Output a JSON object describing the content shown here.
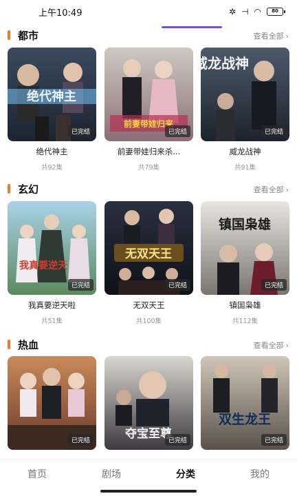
{
  "status_bar": {
    "time": "上午10:49",
    "battery": "80"
  },
  "sections": [
    {
      "title": "都市",
      "more": "查看全部",
      "items": [
        {
          "title": "绝代神主",
          "episodes": "共92集",
          "badge": "已完结",
          "poster_text": "绝代神主"
        },
        {
          "title": "前妻带娃归来杀...",
          "episodes": "共79集",
          "badge": "已完结",
          "poster_text": "前妻带娃归来"
        },
        {
          "title": "威龙战神",
          "episodes": "共91集",
          "badge": "已完结",
          "poster_text": "威龙战神"
        }
      ]
    },
    {
      "title": "玄幻",
      "more": "查看全部",
      "items": [
        {
          "title": "我真要逆天啦",
          "episodes": "共51集",
          "badge": "已完结",
          "poster_text": "我真要逆天"
        },
        {
          "title": "无双天王",
          "episodes": "共100集",
          "badge": "已完结",
          "poster_text": "无双天王"
        },
        {
          "title": "镇国枭雄",
          "episodes": "共112集",
          "badge": "已完结",
          "poster_text": "镇国枭雄"
        }
      ]
    },
    {
      "title": "热血",
      "more": "查看全部",
      "items": [
        {
          "title": "",
          "episodes": "",
          "badge": "已完结",
          "poster_text": ""
        },
        {
          "title": "",
          "episodes": "",
          "badge": "已完结",
          "poster_text": "夺宝至尊"
        },
        {
          "title": "",
          "episodes": "",
          "badge": "已完结",
          "poster_text": "双生龙王"
        }
      ]
    }
  ],
  "tabs": [
    {
      "label": "首页"
    },
    {
      "label": "剧场"
    },
    {
      "label": "分类"
    },
    {
      "label": "我的"
    }
  ],
  "active_tab": 2,
  "colors": {
    "accent": "#f07a2a",
    "tab_indicator": "#7b4dde"
  }
}
